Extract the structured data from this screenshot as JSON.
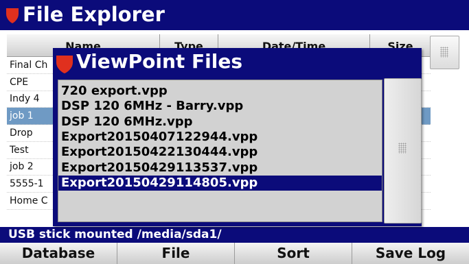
{
  "window": {
    "title": "File Explorer"
  },
  "table": {
    "columns": [
      "Name",
      "Type",
      "Date/Time",
      "Size"
    ],
    "rows": [
      "Final Ch",
      "CPE",
      "Indy 4",
      "job  1",
      "Drop",
      "Test",
      "job 2",
      "5555-1",
      "Home C"
    ],
    "selected_row": 3
  },
  "dialog": {
    "title": "ViewPoint Files",
    "files": [
      "720 export.vpp",
      "DSP 120 6MHz - Barry.vpp",
      "DSP 120 6MHz.vpp",
      "Export20150407122944.vpp",
      "Export20150422130444.vpp",
      "Export20150429113537.vpp",
      "Export20150429114805.vpp"
    ],
    "selected_file": 6
  },
  "status": {
    "text": "USB stick mounted /media/sda1/"
  },
  "softkeys": [
    "Database",
    "File",
    "Sort",
    "Save Log"
  ],
  "colors": {
    "title_bar": "#0b0b7a",
    "accent_shield": "#e0301e",
    "row_selected": "#6f9ac4"
  },
  "icons": {
    "shield": "shield-icon",
    "grip": "grip-icon"
  }
}
